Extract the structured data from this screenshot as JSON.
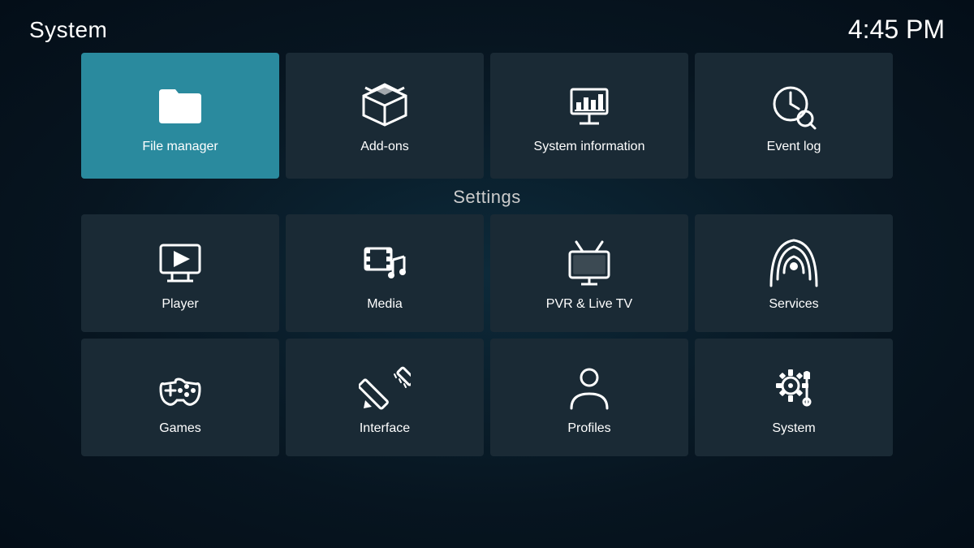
{
  "header": {
    "title": "System",
    "time": "4:45 PM"
  },
  "top_row": {
    "tiles": [
      {
        "id": "file-manager",
        "label": "File manager",
        "icon": "folder"
      },
      {
        "id": "add-ons",
        "label": "Add-ons",
        "icon": "box"
      },
      {
        "id": "system-information",
        "label": "System information",
        "icon": "chart"
      },
      {
        "id": "event-log",
        "label": "Event log",
        "icon": "clock-search"
      }
    ]
  },
  "settings": {
    "heading": "Settings",
    "rows": [
      [
        {
          "id": "player",
          "label": "Player",
          "icon": "monitor-play"
        },
        {
          "id": "media",
          "label": "Media",
          "icon": "film-music"
        },
        {
          "id": "pvr-live-tv",
          "label": "PVR & Live TV",
          "icon": "tv"
        },
        {
          "id": "services",
          "label": "Services",
          "icon": "podcast"
        }
      ],
      [
        {
          "id": "games",
          "label": "Games",
          "icon": "gamepad"
        },
        {
          "id": "interface",
          "label": "Interface",
          "icon": "pencil-ruler"
        },
        {
          "id": "profiles",
          "label": "Profiles",
          "icon": "person"
        },
        {
          "id": "system",
          "label": "System",
          "icon": "gear-tools"
        }
      ]
    ]
  }
}
